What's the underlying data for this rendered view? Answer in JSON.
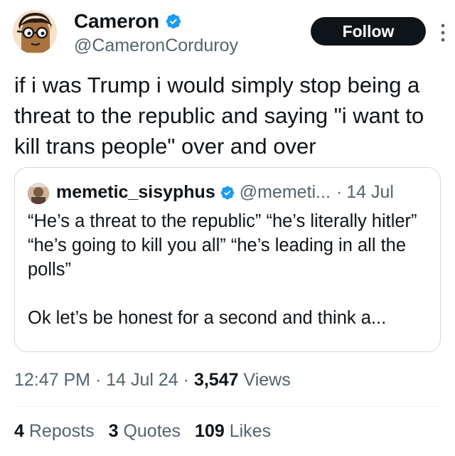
{
  "author": {
    "name": "Cameron",
    "handle": "@CameronCorduroy",
    "follow_label": "Follow"
  },
  "tweet": {
    "text": "if i was Trump i would simply stop being a threat to the republic and saying \"i want to kill trans people\" over and over"
  },
  "quoted_tweet": {
    "name": "memetic_sisyphus",
    "handle": "@memeti...",
    "separator": "·",
    "date": "14 Jul",
    "paragraph1": "“He’s a threat to the republic” “he’s literally hitler” “he’s going to kill you all” “he’s leading in all the polls”",
    "paragraph2": "Ok let’s be honest for a second and think a..."
  },
  "meta": {
    "time": "12:47 PM",
    "separator": "·",
    "date": "14 Jul 24",
    "views_count": "3,547",
    "views_label": "Views"
  },
  "stats": {
    "reposts_count": "4",
    "reposts_label": "Reposts",
    "quotes_count": "3",
    "quotes_label": "Quotes",
    "likes_count": "109",
    "likes_label": "Likes"
  },
  "colors": {
    "text": "#0f1419",
    "secondary": "#536471",
    "verified": "#1d9bf0",
    "border": "#cfd9de"
  },
  "icons": {
    "verified": "verified-badge-icon",
    "more": "more-options-icon"
  }
}
